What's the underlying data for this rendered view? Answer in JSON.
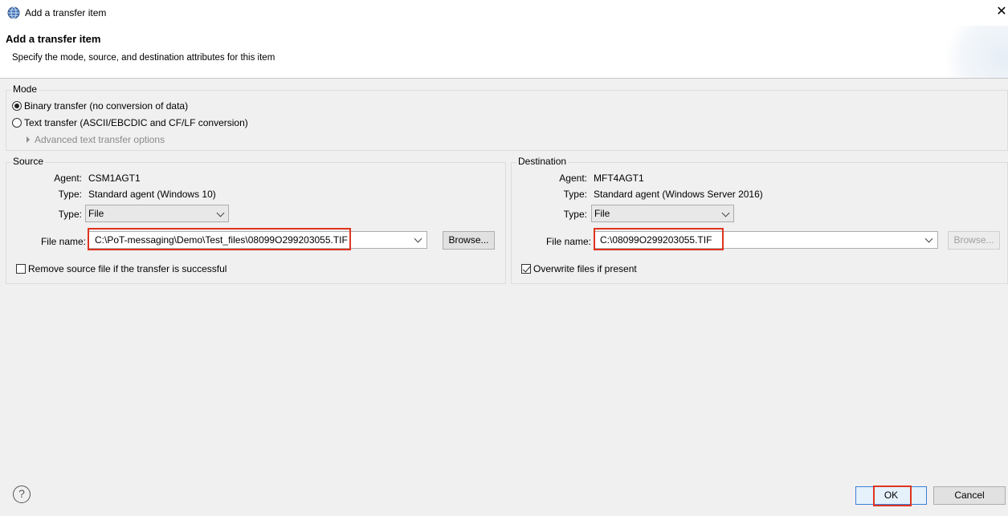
{
  "window": {
    "title": "Add a transfer item"
  },
  "banner": {
    "title": "Add a transfer item",
    "subtitle": "Specify the mode, source, and destination attributes for this item"
  },
  "mode": {
    "label": "Mode",
    "binary_label": "Binary transfer (no conversion of data)",
    "text_label": "Text transfer (ASCII/EBCDIC and CF/LF conversion)",
    "selected": "binary",
    "advanced_label": "Advanced text transfer options"
  },
  "source": {
    "label": "Source",
    "agent_label": "Agent:",
    "agent_value": "CSM1AGT1",
    "type_label": "Type:",
    "type_value": "Standard agent (Windows 10)",
    "type_select_label": "Type:",
    "type_select_value": "File",
    "filename_label": "File name:",
    "filename_value": "C:\\PoT-messaging\\Demo\\Test_files\\08099O299203055.TIF",
    "browse_label": "Browse...",
    "remove_label": "Remove source file if the transfer is successful",
    "remove_checked": false
  },
  "destination": {
    "label": "Destination",
    "agent_label": "Agent:",
    "agent_value": "MFT4AGT1",
    "type_label": "Type:",
    "type_value": "Standard agent (Windows Server 2016)",
    "type_select_label": "Type:",
    "type_select_value": "File",
    "filename_label": "File name:",
    "filename_value": "C:\\08099O299203055.TIF",
    "browse_label": "Browse...",
    "overwrite_label": "Overwrite files if present",
    "overwrite_checked": true
  },
  "footer": {
    "help_glyph": "?",
    "ok_label": "OK",
    "cancel_label": "Cancel"
  },
  "colors": {
    "highlight": "#e0341e",
    "ok_border": "#3c7fd6"
  }
}
